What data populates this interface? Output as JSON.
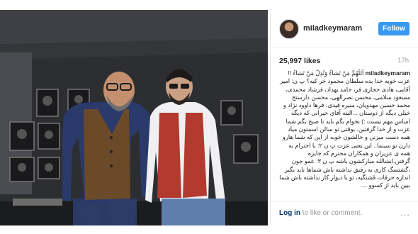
{
  "post": {
    "username": "miladkeymaram",
    "follow_label": "Follow",
    "likes": "25,997 likes",
    "time_ago": "17h",
    "caption_username": "miladkeymaram",
    "caption_text": "اَللّٰهُمَّ مَنْ تَشاءُ وَتُذِلُّ مَنْ تَشاءُ !! عزت خوبه خدا بده سلطان محمود خر کیه؟ پ ن: امیر آقایی، هادی حجازی فر، حامد بهداد، فرشاد محمدی، مسعود سلامی، محسن نصرالهی، محسن دارستج محمد حسین مهدویان، منیره قیدی، فرها داوود نژاد و خیلی دیگه از دوستان ...البته آقای حیرانی که دیگه اساس مهم نیست :) بخوام بگم باید تا صبح بگم شما عزت و از خدا گرفتین. بوقتی تو سالن اسمتون میاد همه دست میزنن و حالشون خوبه از این که شما هارو دارن تو سینما.. این یعنی عزت پ ن ۲: با احترام به همه ی عزیزان و همکاران محترم که جایزه گرفتن.انشالله مبارکشون باشه پ ن ۳: عمو جون ،گشتسگ کاری به رفیق نداشته باش شماها باید بگیر اندازه حرفات قشنگیه، تو با دیوار کار نداشته باش شما ببین باید از کسوو ...."
  },
  "footer": {
    "login_label": "Log in",
    "login_suffix": " to like or comment.",
    "more_label": "..."
  }
}
